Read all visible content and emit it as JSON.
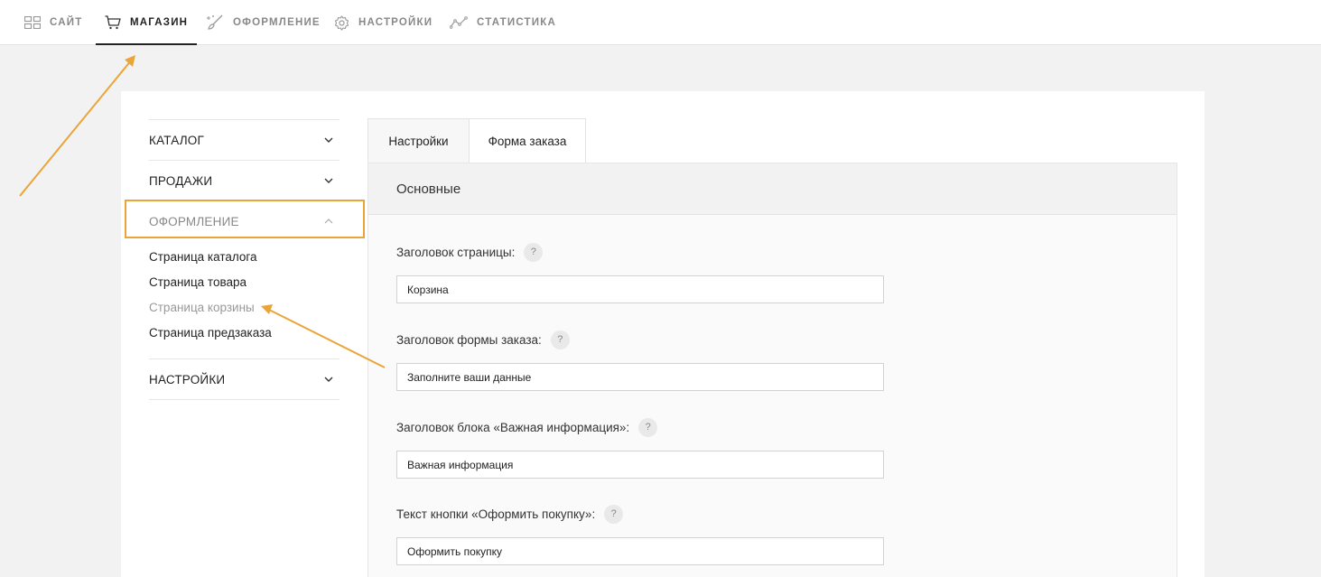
{
  "topnav": {
    "items": [
      {
        "label": "САЙТ",
        "icon": "grid-icon"
      },
      {
        "label": "МАГАЗИН",
        "icon": "cart-icon"
      },
      {
        "label": "ОФОРМЛЕНИЕ",
        "icon": "brush-icon"
      },
      {
        "label": "НАСТРОЙКИ",
        "icon": "gear-icon"
      },
      {
        "label": "СТАТИСТИКА",
        "icon": "stats-icon"
      }
    ],
    "active_index": 1
  },
  "sidebar": {
    "sections": [
      {
        "label": "КАТАЛОГ"
      },
      {
        "label": "ПРОДАЖИ"
      },
      {
        "label": "ОФОРМЛЕНИЕ",
        "expanded": true,
        "items": [
          {
            "label": "Страница каталога"
          },
          {
            "label": "Страница товара"
          },
          {
            "label": "Страница корзины",
            "active": true
          },
          {
            "label": "Страница предзаказа"
          }
        ]
      },
      {
        "label": "НАСТРОЙКИ"
      }
    ]
  },
  "tabs": [
    {
      "label": "Настройки",
      "active": true
    },
    {
      "label": "Форма заказа"
    }
  ],
  "panel": {
    "title": "Основные",
    "help_symbol": "?",
    "fields": [
      {
        "label": "Заголовок страницы:",
        "value": "Корзина"
      },
      {
        "label": "Заголовок формы заказа:",
        "value": "Заполните ваши данные"
      },
      {
        "label": "Заголовок блока «Важная информация»:",
        "value": "Важная информация"
      },
      {
        "label": "Текст кнопки «Оформить покупку»:",
        "value": "Оформить покупку"
      }
    ]
  },
  "colors": {
    "annotation": "#eaa53a",
    "active_text": "#222222",
    "muted_text": "#888888"
  }
}
